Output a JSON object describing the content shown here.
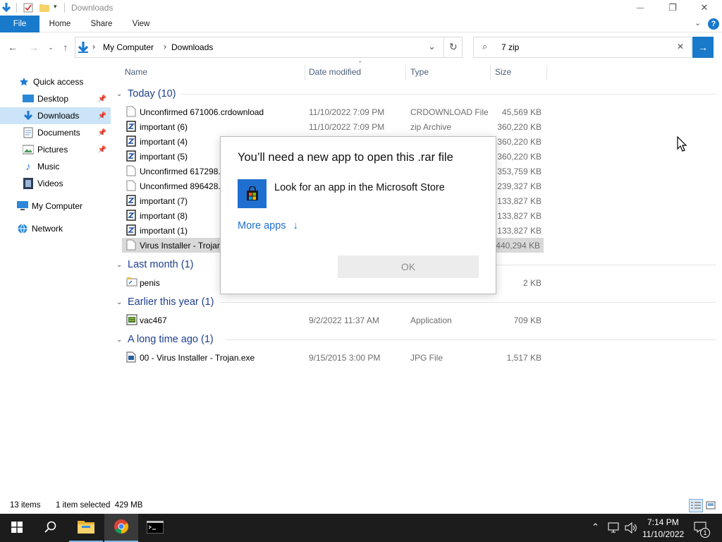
{
  "window": {
    "title": "Downloads",
    "minimize": "—",
    "restore": "❐",
    "close": "✕"
  },
  "ribbon": {
    "tabs": [
      {
        "label": "File"
      },
      {
        "label": "Home"
      },
      {
        "label": "Share"
      },
      {
        "label": "View"
      }
    ],
    "help": "?"
  },
  "address": {
    "path": [
      "My Computer",
      "Downloads"
    ],
    "separator": "›"
  },
  "search": {
    "value": "7 zip",
    "clear": "✕",
    "go": "→"
  },
  "nav": {
    "items": [
      {
        "label": "Quick access",
        "icon": "star-icon"
      },
      {
        "label": "Desktop",
        "icon": "desktop-icon",
        "pinned": true
      },
      {
        "label": "Downloads",
        "icon": "download-icon",
        "pinned": true,
        "selected": true
      },
      {
        "label": "Documents",
        "icon": "documents-icon",
        "pinned": true
      },
      {
        "label": "Pictures",
        "icon": "pictures-icon",
        "pinned": true
      },
      {
        "label": "Music",
        "icon": "music-icon"
      },
      {
        "label": "Videos",
        "icon": "videos-icon"
      },
      {
        "label": "My Computer",
        "icon": "computer-icon"
      },
      {
        "label": "Network",
        "icon": "network-icon"
      }
    ]
  },
  "columns": {
    "name": "Name",
    "date": "Date modified",
    "type": "Type",
    "size": "Size"
  },
  "groups": [
    {
      "label": "Today (10)",
      "rows": [
        {
          "name": "Unconfirmed 671006.crdownload",
          "date": "11/10/2022 7:09 PM",
          "type": "CRDOWNLOAD File",
          "size": "45,569 KB",
          "icon": "file"
        },
        {
          "name": "important (6)",
          "date": "11/10/2022 7:09 PM",
          "type": "zip Archive",
          "size": "360,220 KB",
          "icon": "zip"
        },
        {
          "name": "important (4)",
          "date": "",
          "type": "",
          "size": "360,220 KB",
          "icon": "zip"
        },
        {
          "name": "important (5)",
          "date": "",
          "type": "",
          "size": "360,220 KB",
          "icon": "zip"
        },
        {
          "name": "Unconfirmed 617298.c",
          "date": "",
          "type": "",
          "size": "353,759 KB",
          "icon": "file"
        },
        {
          "name": "Unconfirmed 896428.c",
          "date": "",
          "type": "",
          "size": "239,327 KB",
          "icon": "file"
        },
        {
          "name": "important (7)",
          "date": "",
          "type": "",
          "size": "133,827 KB",
          "icon": "zip"
        },
        {
          "name": "important (8)",
          "date": "",
          "type": "",
          "size": "133,827 KB",
          "icon": "zip"
        },
        {
          "name": "important (1)",
          "date": "",
          "type": "",
          "size": "133,827 KB",
          "icon": "zip"
        },
        {
          "name": "Virus Installer - Trojan",
          "date": "",
          "type": "",
          "size": "440,294 KB",
          "icon": "file",
          "selected": true
        }
      ]
    },
    {
      "label": "Last month (1)",
      "rows": [
        {
          "name": "penis",
          "date": "",
          "type": "",
          "size": "2 KB",
          "icon": "shortcut"
        }
      ]
    },
    {
      "label": "Earlier this year (1)",
      "rows": [
        {
          "name": "vac467",
          "date": "9/2/2022 11:37 AM",
          "type": "Application",
          "size": "709 KB",
          "icon": "app"
        }
      ]
    },
    {
      "label": "A long time ago (1)",
      "rows": [
        {
          "name": "00 - Virus Installer - Trojan.exe",
          "date": "9/15/2015 3:00 PM",
          "type": "JPG File",
          "size": "1,517 KB",
          "icon": "image"
        }
      ]
    }
  ],
  "dialog": {
    "title": "You’ll need a new app to open this .rar file",
    "store_option": "Look for an app in the Microsoft Store",
    "more_apps": "More apps",
    "more_apps_arrow": "↓",
    "ok": "OK"
  },
  "status": {
    "item_count": "13 items",
    "selection": "1 item selected  429 MB"
  },
  "taskbar": {
    "time": "7:14 PM",
    "date": "11/10/2022",
    "notifications": "1"
  },
  "colors": {
    "accent": "#1979ca",
    "group_header": "#1e3f8f",
    "selection": "#cce4f7",
    "taskbar": "#1c1c1c"
  }
}
